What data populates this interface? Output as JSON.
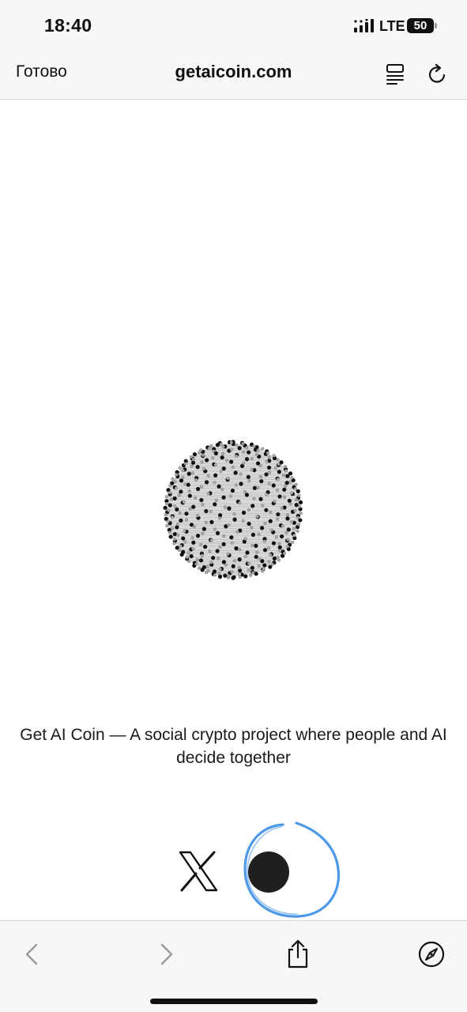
{
  "status_bar": {
    "time": "18:40",
    "network": "LTE",
    "battery": "50"
  },
  "nav": {
    "done_label": "Готово",
    "url": "getaicoin.com",
    "icons": [
      "reader-icon",
      "reload-icon"
    ]
  },
  "content": {
    "tagline": "Get AI Coin — A social crypto project where people and AI decide together",
    "links": [
      "x-logo-icon",
      "dot-icon"
    ],
    "annotation_color": "#3b8ee6"
  },
  "toolbar": {
    "icons": [
      "back-chevron-icon",
      "forward-chevron-icon",
      "share-icon",
      "compass-icon"
    ]
  },
  "colors": {
    "bar_background": "#f7f7f7",
    "text": "#111111",
    "disabled_icon": "#9a9a9a",
    "annotation": "#3b8ee6"
  }
}
